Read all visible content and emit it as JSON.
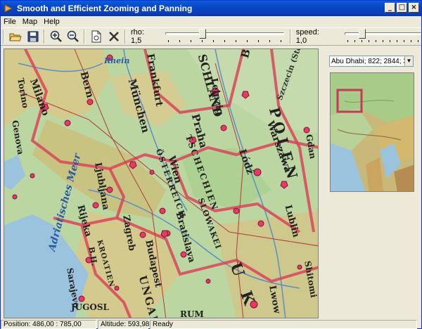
{
  "window": {
    "title": "Smooth and Efficient Zooming and Panning"
  },
  "menu": {
    "items": [
      "File",
      "Map",
      "Help"
    ]
  },
  "toolbar": {
    "rho_label": "rho: 1,5",
    "speed_label": "speed: 1,0",
    "rho_value": 0.3,
    "speed_value": 0.2
  },
  "combo": {
    "value": "Abu Dhabi; 822; 2844; 305;"
  },
  "status": {
    "position": "Position: 486,00 : 785,00",
    "altitude": "Altitude: 593,98",
    "state": "Ready"
  },
  "map_labels": {
    "berlin": "Berlin",
    "stettin": "Szczecin (Stettin)",
    "rhein": "Rhein",
    "milano": "Milano",
    "bern": "Bern",
    "frankfurt": "Frankfurt",
    "munchen": "München",
    "schland": "SCHLAND",
    "leipzig": "Leipzig",
    "praha": "Praha",
    "polen": "POLEN",
    "warszawa": "Warszawa",
    "lodz": "Łódź",
    "tschechien": "TSCHECHIEN",
    "osterreich": "ÖSTERREICH",
    "wien": "Wien",
    "ljubljana": "Ljubljana",
    "zagreb": "Zagreb",
    "budapest": "Budapest",
    "slowakei": "SLOWAKEI",
    "bratislava": "Bratislava",
    "ungarn": "UNGARN",
    "lublin": "Lublin",
    "lwow": "Lwow",
    "rijeka": "Rijeka",
    "kroatien": "KROATIEN",
    "adriatisches": "Adriatisches Meer",
    "sarajevo": "Sarajevo",
    "jugosl": "JUGOSL",
    "rum": "RUM",
    "ukr": "U K R",
    "shitomi": "Shitomi",
    "genova": "Genova",
    "torino": "Torino",
    "gdansk": "Gdan",
    "bh": "B.H."
  },
  "colors": {
    "titlebar": "#0845c6",
    "water": "#9cc3dd",
    "land": "#b9d6a5",
    "border": "#d9445a"
  }
}
